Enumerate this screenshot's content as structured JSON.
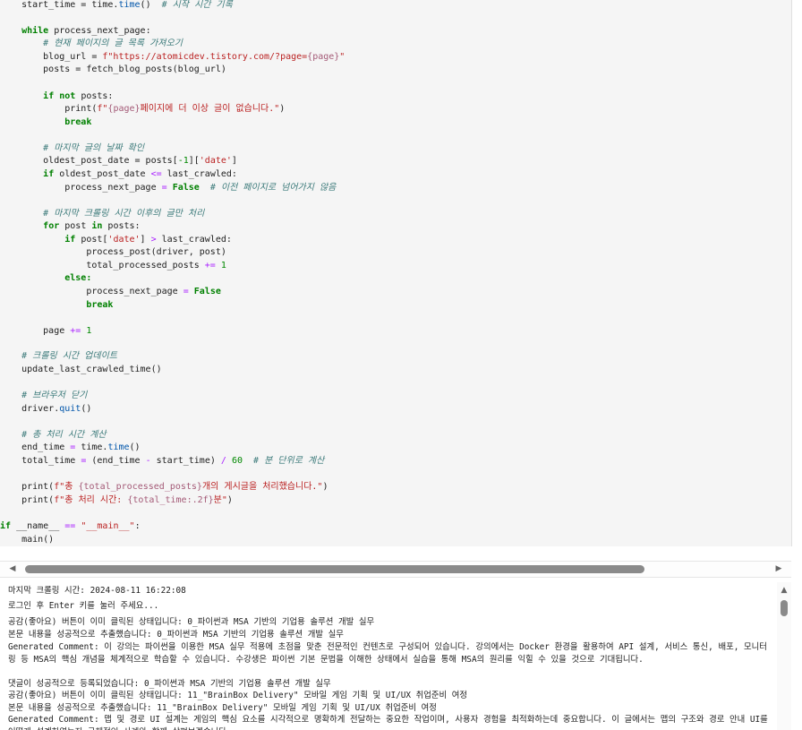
{
  "code": {
    "l01": {
      "a": "    start_time = time.",
      "b": "time",
      "c": "()  ",
      "d": "# 시작 시간 기록"
    },
    "l03": {
      "kw": "while",
      "rest": " process_next_page:"
    },
    "l04": "# 현재 페이지의 글 목록 가져오기",
    "l05": {
      "a": "        blog_url = ",
      "b": "f\"https://atomicdev.tistory.com/?page=",
      "c": "{page}",
      "d": "\""
    },
    "l06": "        posts = fetch_blog_posts(blog_url)",
    "l08": {
      "kw1": "if",
      "kw2": "not",
      "rest": " posts:"
    },
    "l09": {
      "a": "            print(",
      "b": "f\"",
      "c": "{page}",
      "d": "페이지에 더 이상 글이 없습니다.\"",
      "e": ")"
    },
    "l10": "break",
    "l12": "# 마지막 글의 날짜 확인",
    "l13": {
      "a": "        oldest_post_date = posts[",
      "b": "-1",
      "c": "][",
      "d": "'date'",
      "e": "]"
    },
    "l14": {
      "kw": "if",
      "a": " oldest_post_date ",
      "op": "<=",
      "b": " last_crawled:"
    },
    "l15": {
      "a": "            process_next_page ",
      "op": "=",
      "kw": "False",
      "cm": "# 이전 페이지로 넘어가지 않음"
    },
    "l17": "# 마지막 크롤링 시간 이후의 글만 처리",
    "l18": {
      "kw1": "for",
      "a": " post ",
      "kw2": "in",
      "b": " posts:"
    },
    "l19": {
      "kw": "if",
      "a": " post[",
      "s": "'date'",
      "b": "] ",
      "op": ">",
      "c": " last_crawled:"
    },
    "l20": "                process_post(driver, post)",
    "l21": {
      "a": "                total_processed_posts ",
      "op": "+=",
      "n": "1"
    },
    "l22": "else:",
    "l23": {
      "a": "                process_next_page ",
      "op": "=",
      "kw": "False"
    },
    "l24": "break",
    "l26": {
      "a": "        page ",
      "op": "+=",
      "n": "1"
    },
    "l28": "# 크롤링 시간 업데이트",
    "l29": "    update_last_crawled_time()",
    "l31": "# 브라우저 닫기",
    "l32": {
      "a": "    driver.",
      "b": "quit",
      "c": "()"
    },
    "l34": "# 총 처리 시간 계산",
    "l35": {
      "a": "    end_time ",
      "op": "=",
      "b": " time.",
      "fn": "time",
      "c": "()"
    },
    "l36": {
      "a": "    total_time ",
      "op1": "=",
      "b": " (end_time ",
      "op2": "-",
      "c": " start_time) ",
      "op3": "/",
      "n": "60",
      "cm": "# 분 단위로 계산"
    },
    "l38": {
      "a": "    print(",
      "b": "f\"총 ",
      "c": "{total_processed_posts}",
      "d": "개의 게시글을 처리했습니다.\"",
      "e": ")"
    },
    "l39": {
      "a": "    print(",
      "b": "f\"총 처리 시간: ",
      "c": "{total_time:.2f}",
      "d": "분\"",
      "e": ")"
    },
    "l41": {
      "kw": "if",
      "a": " __name__ ",
      "op": "==",
      "s": "\"__main__\"",
      "b": ":"
    },
    "l42": "    main()"
  },
  "output": {
    "lines": [
      "마지막 크롤링 시간: 2024-08-11 16:22:08",
      "로그인 후 Enter 키를 눌러 주세요...",
      "공감(좋아요) 버튼이 이미 클릭된 상태입니다: 0_파이썬과 MSA 기반의 기업용 솔루션 개발 실무",
      "본문 내용을 성공적으로 추출했습니다: 0_파이썬과 MSA 기반의 기업용 솔루션 개발 실무",
      "Generated Comment: 이 강의는 파이썬을 이용한 MSA 실무 적용에 초점을 맞춘 전문적인 컨텐츠로 구성되어 있습니다. 강의에서는 Docker 환경을 활용하여 API 설계, 서비스 통신, 배포, 모니터링 등 MSA의 핵심 개념을 체계적으로 학습할 수 있습니다. 수강생은 파이썬 기본 문법을 이해한 상태에서 실습을 통해 MSA의 원리를 익힐 수 있을 것으로 기대됩니다.",
      "댓글이 성공적으로 등록되었습니다: 0_파이썬과 MSA 기반의 기업용 솔루션 개발 실무",
      "공감(좋아요) 버튼이 이미 클릭된 상태입니다: 11_\"BrainBox Delivery\" 모바일 게임 기획 및 UI/UX 취업준비 여정",
      "본문 내용을 성공적으로 추출했습니다: 11_\"BrainBox Delivery\" 모바일 게임 기획 및 UI/UX 취업준비 여정",
      "Generated Comment: 맵 및 경로 UI 설계는 게임의 핵심 요소를 시각적으로 명확하게 전달하는 중요한 작업이며, 사용자 경험을 최적화하는데 중요합니다. 이 글에서는 맵의 구조와 경로 안내 UI를 어떻게 설계하였는지 구체적인 사례와 함께 살펴보겠습니다."
    ]
  }
}
